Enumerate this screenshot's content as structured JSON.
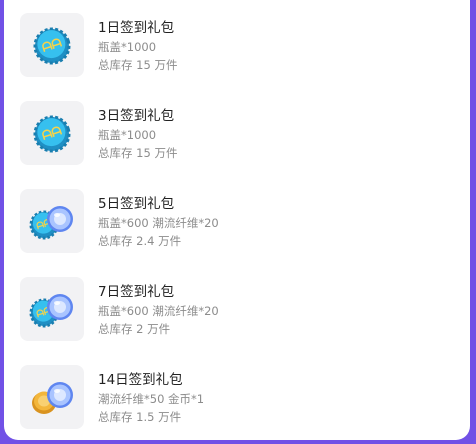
{
  "rewards": [
    {
      "title": "1日签到礼包",
      "desc": "瓶盖*1000",
      "stock": "总库存 15 万件",
      "icon": "bottle-cap-icon"
    },
    {
      "title": "3日签到礼包",
      "desc": "瓶盖*1000",
      "stock": "总库存 15 万件",
      "icon": "bottle-cap-icon"
    },
    {
      "title": "5日签到礼包",
      "desc": "瓶盖*600 潮流纤维*20",
      "stock": "总库存 2.4 万件",
      "icon": "cap-and-fiber-icon"
    },
    {
      "title": "7日签到礼包",
      "desc": "瓶盖*600 潮流纤维*20",
      "stock": "总库存 2 万件",
      "icon": "cap-and-fiber-icon"
    },
    {
      "title": "14日签到礼包",
      "desc": "潮流纤维*50 金币*1",
      "stock": "总库存 1.5 万件",
      "icon": "coin-and-fiber-icon"
    }
  ],
  "colors": {
    "background": "#7151e6",
    "card": "#ffffff",
    "cap": "#2fb8e8",
    "fiber": "#7fa6ff",
    "coin": "#f3b63b"
  }
}
